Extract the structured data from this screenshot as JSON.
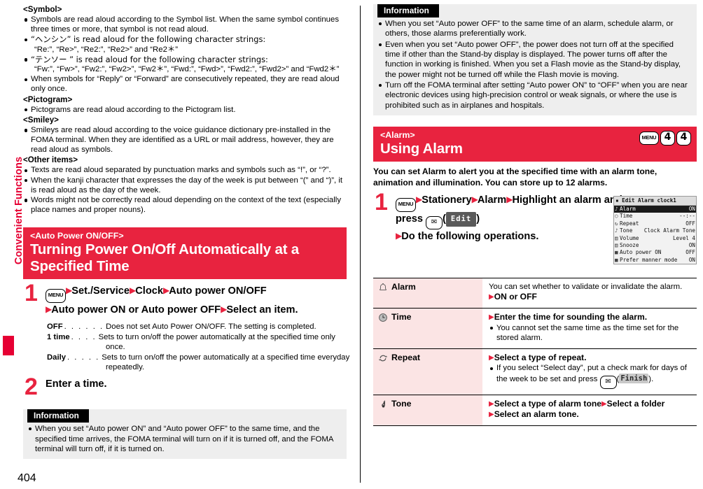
{
  "page": {
    "number": "404"
  },
  "sidebar": {
    "chapter_label": "Convenient Functions"
  },
  "left_column": {
    "sections": [
      {
        "heading": "<Symbol>",
        "bullets": [
          "Symbols are read aloud according to the Symbol list. When the same symbol continues three times or more, that symbol is not read aloud.",
          "“ヘンシン” is read aloud for the following character strings:",
          "“テンソー ” is read aloud for the following character strings:",
          "When symbols for “Reply” or “Forward” are consecutively repeated, they are read aloud only once."
        ],
        "sub_lines": [
          "“Re:”, “Re>”, “Re2:”, “Re2>” and “Re2＊”",
          "“Fw:”, “Fw>”, “Fw2:”, “Fw2>”, “Fw2＊”, “Fwd:”, “Fwd>”, “Fwd2:”, “Fwd2>” and “Fwd2＊”"
        ]
      },
      {
        "heading": "<Pictogram>",
        "bullets": [
          "Pictograms are read aloud according to the Pictogram list."
        ]
      },
      {
        "heading": "<Smiley>",
        "bullets": [
          "Smileys are read aloud according to the voice guidance dictionary pre-installed in the FOMA terminal. When they are identified as a URL or mail address, however, they are read aloud as symbols."
        ]
      },
      {
        "heading": "<Other items>",
        "bullets": [
          "Texts are read aloud separated by punctuation marks and symbols such as “!”, or “?”.",
          "When the kanji character that expresses the day of the week is put between “(” and “)”, it is read aloud as the day of the week.",
          "Words might not be correctly read aloud depending on the context of the text (especially place names and proper nouns)."
        ]
      }
    ],
    "banner": {
      "tag": "<Auto Power ON/OFF>",
      "title": "Turning Power On/Off Automatically at a Specified Time"
    },
    "step1": {
      "number": "1",
      "menu_key": "MENU",
      "line1_parts": [
        "Set./Service",
        "Clock",
        "Auto power ON/OFF"
      ],
      "line2_parts": [
        "Auto power ON or Auto power OFF",
        "Select an item."
      ]
    },
    "definitions": [
      {
        "term": "OFF",
        "dots": ". . . . . .",
        "desc": "Does not set Auto Power ON/OFF. The setting is completed.",
        "cont": ""
      },
      {
        "term": "1 time",
        "dots": ". . . .",
        "desc": "Sets to turn on/off the power automatically at the specified time only",
        "cont": "once."
      },
      {
        "term": "Daily",
        "dots": ". . . . .",
        "desc": "Sets to turn on/off the power automatically at a specified time everyday",
        "cont": "repeatedly."
      }
    ],
    "step2": {
      "number": "2",
      "text": "Enter a time."
    },
    "information": {
      "header": "Information",
      "bullets": [
        "When you set “Auto power ON” and “Auto power OFF” to the same time, and the specified time arrives, the FOMA terminal will turn on if it is turned off, and the FOMA terminal will turn off, if it is turned on."
      ]
    }
  },
  "right_column": {
    "information": {
      "header": "Information",
      "bullets": [
        "When you set “Auto power OFF” to the same time of an alarm, schedule alarm, or others, those alarms preferentially work.",
        "Even when you set “Auto power OFF”, the power does not turn off at the specified time if other than the Stand-by display is displayed. The power turns off after the function in working is finished. When you set a Flash movie as the Stand-by display, the power might not be turned off while the Flash movie is moving.",
        "Turn off the FOMA terminal after setting “Auto power ON” to “OFF” when you are near electronic devices using high-precision control or weak signals, or where the use is prohibited such as in airplanes and hospitals."
      ]
    },
    "banner": {
      "tag": "<Alarm>",
      "title": "Using Alarm",
      "key_sequence": [
        "MENU",
        "4",
        "4"
      ]
    },
    "intro": "You can set Alarm to alert you at the specified time with an alarm tone, animation and illumination. You can store up to 12 alarms.",
    "step1": {
      "number": "1",
      "menu_key": "MENU",
      "parts": [
        "Stationery",
        "Alarm",
        "Highlight an alarm and press"
      ],
      "mail_key": "✉",
      "softkey": "Edit",
      "line3": "Do the following operations."
    },
    "lcd": {
      "title": "Edit Alarm clock1",
      "rows": [
        {
          "icon": "♪",
          "key": "Alarm",
          "value": "ON",
          "selected": true
        },
        {
          "icon": "○",
          "key": "Time",
          "value": "--:--",
          "selected": false
        },
        {
          "icon": "↻",
          "key": "Repeat",
          "value": "OFF",
          "selected": false
        },
        {
          "icon": "♪",
          "key": "Tone",
          "value": "Clock Alarm Tone",
          "selected": false
        },
        {
          "icon": "▤",
          "key": "Volume",
          "value": "Level 4",
          "selected": false
        },
        {
          "icon": "▤",
          "key": "Snooze",
          "value": "ON",
          "selected": false
        },
        {
          "icon": "■",
          "key": "Auto power ON",
          "value": "OFF",
          "selected": false
        },
        {
          "icon": "■",
          "key": "Prefer manner mode",
          "value": "ON",
          "selected": false
        }
      ]
    },
    "options": [
      {
        "icon": "bell-icon",
        "label": "Alarm",
        "desc_lines": [
          "You can set whether to validate or invalidate the alarm."
        ],
        "actions": [
          "ON or OFF"
        ],
        "notes": []
      },
      {
        "icon": "clock-icon",
        "label": "Time",
        "desc_lines": [],
        "actions": [
          "Enter the time for sounding the alarm."
        ],
        "notes": [
          "You cannot set the same time as the time set for the stored alarm."
        ]
      },
      {
        "icon": "repeat-icon",
        "label": "Repeat",
        "desc_lines": [],
        "actions": [
          "Select a type of repeat."
        ],
        "notes": [
          "If you select “Select day”, put a check mark for days of the week to be set and press"
        ],
        "note_softkey": "Finish",
        "note_mail_key": "✉",
        "note_tail": "."
      },
      {
        "icon": "music-note-icon",
        "label": "Tone",
        "desc_lines": [],
        "actions": [
          "Select a type of alarm tone",
          "Select a folder",
          "Select an alarm tone."
        ],
        "notes": []
      }
    ]
  }
}
